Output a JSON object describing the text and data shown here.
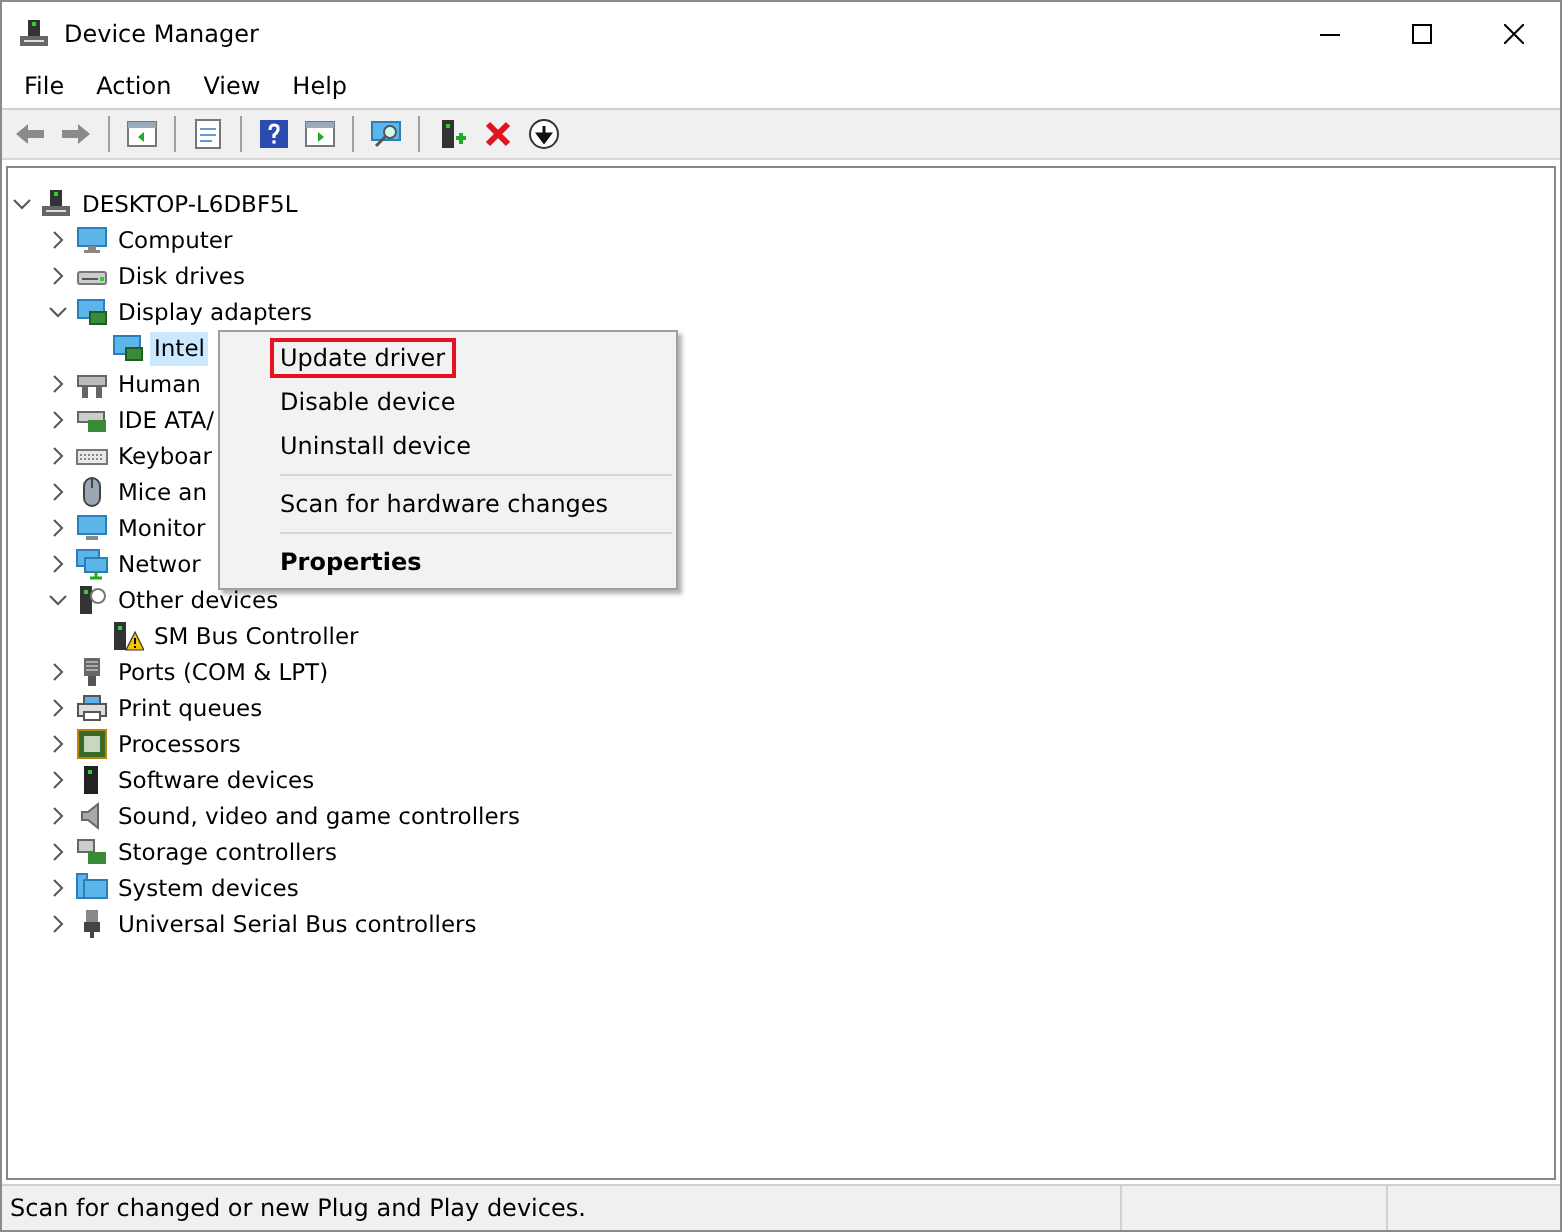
{
  "window": {
    "title": "Device Manager"
  },
  "menu_bar": [
    "File",
    "Action",
    "View",
    "Help"
  ],
  "tree": [
    {
      "label": "DESKTOP-L6DBF5L",
      "expanded": true,
      "selected": false,
      "children": [
        {
          "label": "Computer",
          "expanded": false,
          "selected": false
        },
        {
          "label": "Disk drives",
          "expanded": false,
          "selected": false
        },
        {
          "label": "Display adapters",
          "expanded": true,
          "selected": false,
          "children": [
            {
              "label": "Intel",
              "selected": true
            }
          ]
        },
        {
          "label": "Human",
          "expanded": false,
          "selected": false
        },
        {
          "label": "IDE ATA/",
          "expanded": false,
          "selected": false
        },
        {
          "label": "Keyboar",
          "expanded": false,
          "selected": false
        },
        {
          "label": "Mice an",
          "expanded": false,
          "selected": false
        },
        {
          "label": "Monitor",
          "expanded": false,
          "selected": false
        },
        {
          "label": "Networ",
          "expanded": false,
          "selected": false
        },
        {
          "label": "Other devices",
          "expanded": true,
          "selected": false,
          "children": [
            {
              "label": "SM Bus Controller",
              "selected": false
            }
          ]
        },
        {
          "label": "Ports (COM & LPT)",
          "expanded": false,
          "selected": false
        },
        {
          "label": "Print queues",
          "expanded": false,
          "selected": false
        },
        {
          "label": "Processors",
          "expanded": false,
          "selected": false
        },
        {
          "label": "Software devices",
          "expanded": false,
          "selected": false
        },
        {
          "label": "Sound, video and game controllers",
          "expanded": false,
          "selected": false
        },
        {
          "label": "Storage controllers",
          "expanded": false,
          "selected": false
        },
        {
          "label": "System devices",
          "expanded": false,
          "selected": false
        },
        {
          "label": "Universal Serial Bus controllers",
          "expanded": false,
          "selected": false
        }
      ]
    }
  ],
  "context_menu": [
    {
      "kind": "item",
      "label": "Update driver",
      "highlighted": true,
      "default": false
    },
    {
      "kind": "item",
      "label": "Disable device",
      "highlighted": false,
      "default": false
    },
    {
      "kind": "item",
      "label": "Uninstall device",
      "highlighted": false,
      "default": false
    },
    {
      "kind": "separator"
    },
    {
      "kind": "item",
      "label": "Scan for hardware changes",
      "highlighted": false,
      "default": false
    },
    {
      "kind": "separator"
    },
    {
      "kind": "item",
      "label": "Properties",
      "highlighted": false,
      "default": true
    }
  ],
  "status_bar": "Scan for changed or new Plug and Play devices."
}
